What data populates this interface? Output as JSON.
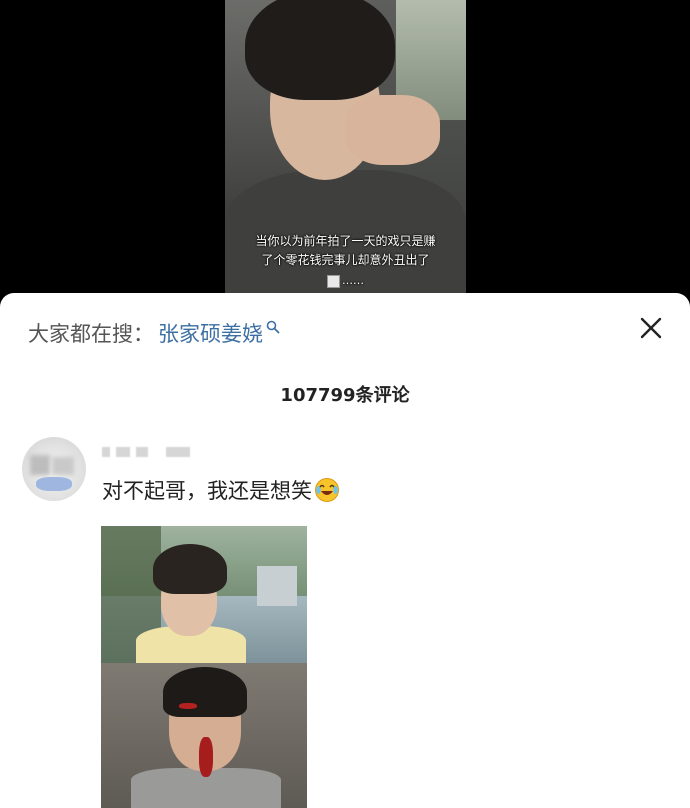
{
  "video": {
    "subtitle_line1": "当你以为前年拍了一天的戏只是赚",
    "subtitle_line2": "了个零花钱完事儿却意外丑出了",
    "subtitle_line3": "……"
  },
  "search": {
    "prefix": "大家都在搜：",
    "term": "张家硕姜娆"
  },
  "comments": {
    "count_label": "107799条评论",
    "items": [
      {
        "text": "对不起哥，我还是想笑",
        "emoji": "laughing-crying-emoji",
        "attachment": "meme-image"
      }
    ]
  },
  "icons": {
    "search": "search-icon",
    "close": "close-icon"
  },
  "colors": {
    "search_term": "#3d6fa3",
    "sheet_bg": "#ffffff",
    "backdrop": "#000000"
  }
}
